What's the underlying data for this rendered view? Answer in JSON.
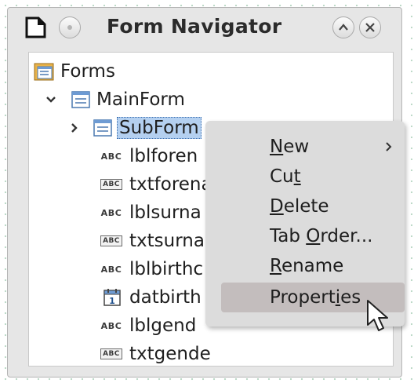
{
  "window": {
    "title": "Form Navigator",
    "icons": {
      "app": "navigator-icon",
      "minimize": "minimize-icon",
      "shade": "chevron-up-icon",
      "close": "close-icon"
    }
  },
  "tree": {
    "root": {
      "label": "Forms",
      "icon": "forms-folder-icon"
    },
    "main_form": {
      "label": "MainForm",
      "icon": "form-icon"
    },
    "sub_form": {
      "label": "SubForm",
      "icon": "form-icon",
      "selected": true
    },
    "controls": [
      {
        "label": "lblforen",
        "icon": "label-field-icon",
        "badge": "ABC"
      },
      {
        "label": "txtforena",
        "icon": "text-box-icon",
        "badge": "ABC"
      },
      {
        "label": "lblsurna",
        "icon": "label-field-icon",
        "badge": "ABC"
      },
      {
        "label": "txtsurna",
        "icon": "text-box-icon",
        "badge": "ABC"
      },
      {
        "label": "lblbirthc",
        "icon": "label-field-icon",
        "badge": "ABC"
      },
      {
        "label": "datbirth",
        "icon": "date-field-icon",
        "badge": "1"
      },
      {
        "label": "lblgend",
        "icon": "label-field-icon",
        "badge": "ABC"
      },
      {
        "label": "txtgende",
        "icon": "text-box-icon",
        "badge": "ABC"
      }
    ]
  },
  "context_menu": {
    "items": [
      {
        "label": "New",
        "mnemonic": "N",
        "has_submenu": true
      },
      {
        "label": "Cut",
        "mnemonic": "t"
      },
      {
        "label": "Delete",
        "mnemonic": "D"
      },
      {
        "label": "Tab Order...",
        "mnemonic": "O"
      },
      {
        "label": "Rename",
        "mnemonic": "R"
      },
      {
        "label": "Properties",
        "mnemonic": "i",
        "highlighted": true
      }
    ]
  },
  "colors": {
    "window_bg": "#e6e6e6",
    "selection": "#b4d0f0",
    "menu_bg": "#dcdcdc",
    "menu_hover": "#c3bdbd"
  }
}
